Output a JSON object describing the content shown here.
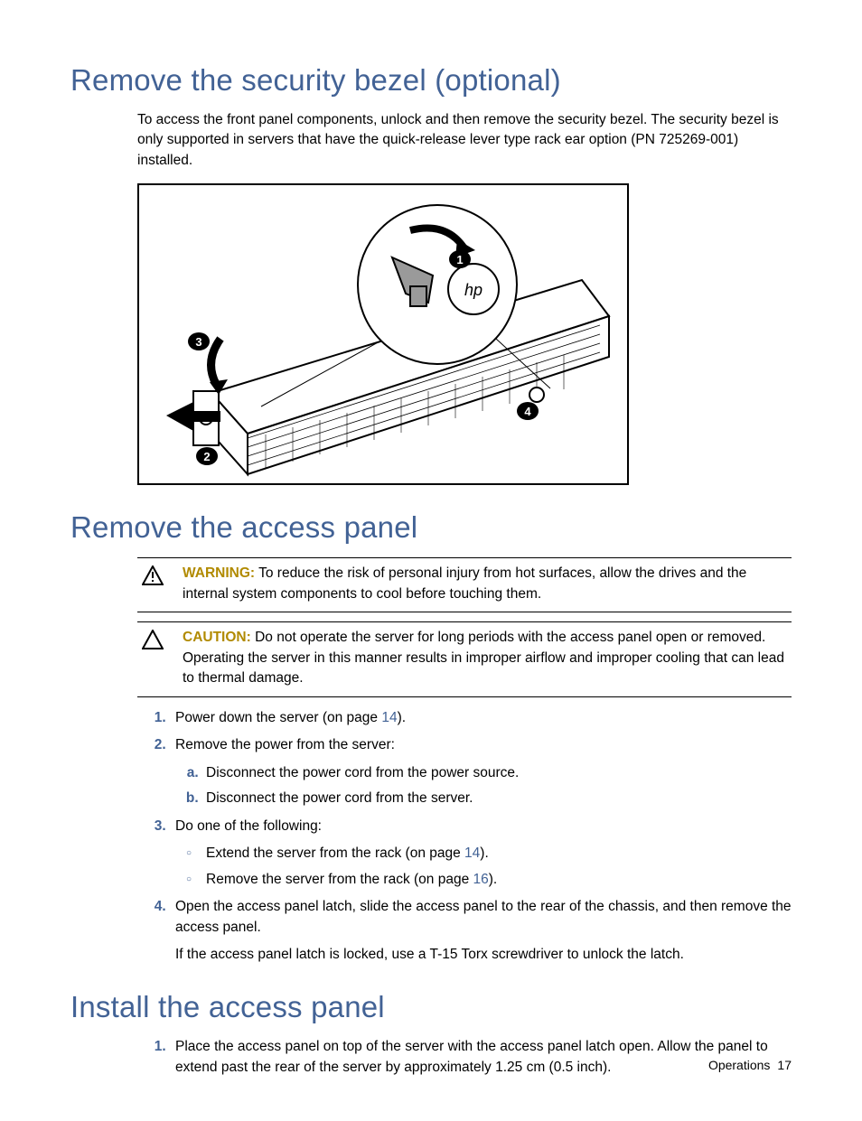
{
  "section1": {
    "heading": "Remove the security bezel (optional)",
    "para": "To access the front panel components, unlock and then remove the security bezel. The security bezel is only supported in servers that have the quick-release lever type rack ear option (PN 725269-001) installed.",
    "figure_callouts": [
      "1",
      "2",
      "3",
      "4"
    ]
  },
  "section2": {
    "heading": "Remove the access panel",
    "warning_label": "WARNING:",
    "warning_text": " To reduce the risk of personal injury from hot surfaces, allow the drives and the internal system components to cool before touching them.",
    "caution_label": "CAUTION:",
    "caution_text": " Do not operate the server for long periods with the access panel open or removed. Operating the server in this manner results in improper airflow and improper cooling that can lead to thermal damage.",
    "steps": {
      "s1_pre": "Power down the server (on page ",
      "s1_link": "14",
      "s1_post": ").",
      "s2": "Remove the power from the server:",
      "s2a": "Disconnect the power cord from the power source.",
      "s2b": "Disconnect the power cord from the server.",
      "s3": "Do one of the following:",
      "s3o1_pre": "Extend the server from the rack (on page ",
      "s3o1_link": "14",
      "s3o1_post": ").",
      "s3o2_pre": "Remove the server from the rack (on page ",
      "s3o2_link": "16",
      "s3o2_post": ").",
      "s4": "Open the access panel latch, slide the access panel to the rear of the chassis, and then remove the access panel.",
      "s4_note": "If the access panel latch is locked, use a T-15 Torx screwdriver to unlock the latch."
    }
  },
  "section3": {
    "heading": "Install the access panel",
    "steps": {
      "s1": "Place the access panel on top of the server with the access panel latch open. Allow the panel to extend past the rear of the server by approximately 1.25 cm (0.5 inch)."
    }
  },
  "footer": {
    "section": "Operations",
    "page": "17"
  }
}
